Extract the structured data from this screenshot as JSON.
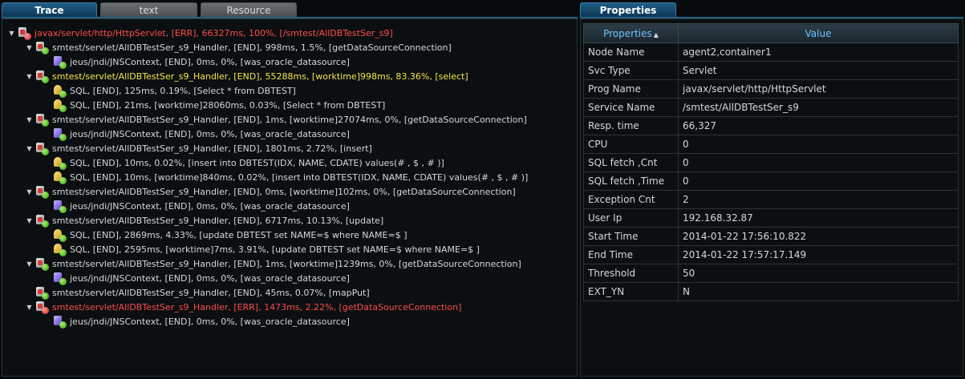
{
  "tabs": [
    {
      "label": "Trace",
      "active": true
    },
    {
      "label": "text",
      "active": false
    },
    {
      "label": "Resource",
      "active": false
    }
  ],
  "properties_tab": {
    "label": "Properties"
  },
  "tree": [
    {
      "depth": 0,
      "toggle": "▼",
      "icon": "service-error-icon",
      "style": "e",
      "text": "javax/servlet/http/HttpServlet, [ERR], 66327ms, 100%, [/smtest/AllDBTestSer_s9]"
    },
    {
      "depth": 1,
      "toggle": "▼",
      "icon": "service-icon",
      "style": "n",
      "text": "smtest/servlet/AllDBTestSer_s9_Handler, [END], 998ms, 1.5%, [getDataSourceConnection]"
    },
    {
      "depth": 2,
      "toggle": "",
      "icon": "jndi-icon",
      "style": "n",
      "text": "jeus/jndi/JNSContext, [END], 0ms, 0%, [was_oracle_datasource]"
    },
    {
      "depth": 1,
      "toggle": "▼",
      "icon": "service-icon",
      "style": "y",
      "text": "smtest/servlet/AllDBTestSer_s9_Handler, [END], 55288ms, [worktime]998ms, 83.36%, [select]"
    },
    {
      "depth": 2,
      "toggle": "",
      "icon": "sql-icon",
      "style": "n",
      "text": "SQL, [END], 125ms, 0.19%, [Select * from DBTEST]"
    },
    {
      "depth": 2,
      "toggle": "",
      "icon": "sql-icon",
      "style": "n",
      "text": "SQL, [END], 21ms, [worktime]28060ms, 0.03%, [Select * from DBTEST]"
    },
    {
      "depth": 1,
      "toggle": "▼",
      "icon": "service-icon",
      "style": "n",
      "text": "smtest/servlet/AllDBTestSer_s9_Handler, [END], 1ms, [worktime]27074ms, 0%, [getDataSourceConnection]"
    },
    {
      "depth": 2,
      "toggle": "",
      "icon": "jndi-icon",
      "style": "n",
      "text": "jeus/jndi/JNSContext, [END], 0ms, 0%, [was_oracle_datasource]"
    },
    {
      "depth": 1,
      "toggle": "▼",
      "icon": "service-icon",
      "style": "n",
      "text": "smtest/servlet/AllDBTestSer_s9_Handler, [END], 1801ms, 2.72%, [insert]"
    },
    {
      "depth": 2,
      "toggle": "",
      "icon": "sql-icon",
      "style": "n",
      "text": "SQL, [END], 10ms, 0.02%, [insert into DBTEST(IDX, NAME, CDATE) values(# , $ , # )]"
    },
    {
      "depth": 2,
      "toggle": "",
      "icon": "sql-icon",
      "style": "n",
      "text": "SQL, [END], 10ms, [worktime]840ms, 0.02%, [insert into DBTEST(IDX, NAME, CDATE) values(# , $ , # )]"
    },
    {
      "depth": 1,
      "toggle": "▼",
      "icon": "service-icon",
      "style": "n",
      "text": "smtest/servlet/AllDBTestSer_s9_Handler, [END], 0ms, [worktime]102ms, 0%, [getDataSourceConnection]"
    },
    {
      "depth": 2,
      "toggle": "",
      "icon": "jndi-icon",
      "style": "n",
      "text": "jeus/jndi/JNSContext, [END], 0ms, 0%, [was_oracle_datasource]"
    },
    {
      "depth": 1,
      "toggle": "▼",
      "icon": "service-icon",
      "style": "n",
      "text": "smtest/servlet/AllDBTestSer_s9_Handler, [END], 6717ms, 10.13%, [update]"
    },
    {
      "depth": 2,
      "toggle": "",
      "icon": "sql-icon",
      "style": "n",
      "text": "SQL, [END], 2869ms, 4.33%, [update DBTEST set NAME=$  where NAME=$ ]"
    },
    {
      "depth": 2,
      "toggle": "",
      "icon": "sql-icon",
      "style": "n",
      "text": "SQL, [END], 2595ms, [worktime]7ms, 3.91%, [update DBTEST set NAME=$  where NAME=$ ]"
    },
    {
      "depth": 1,
      "toggle": "▼",
      "icon": "service-icon",
      "style": "n",
      "text": "smtest/servlet/AllDBTestSer_s9_Handler, [END], 1ms, [worktime]1239ms, 0%, [getDataSourceConnection]"
    },
    {
      "depth": 2,
      "toggle": "",
      "icon": "jndi-icon",
      "style": "n",
      "text": "jeus/jndi/JNSContext, [END], 0ms, 0%, [was_oracle_datasource]"
    },
    {
      "depth": 1,
      "toggle": "",
      "icon": "service-icon",
      "style": "n",
      "text": "smtest/servlet/AllDBTestSer_s9_Handler, [END], 45ms, 0.07%, [mapPut]"
    },
    {
      "depth": 1,
      "toggle": "▼",
      "icon": "service-error-icon",
      "style": "e",
      "text": "smtest/servlet/AllDBTestSer_s9_Handler, [ERR], 1473ms, 2.22%, [getDataSourceConnection]"
    },
    {
      "depth": 2,
      "toggle": "",
      "icon": "jndi-icon",
      "style": "n",
      "text": "jeus/jndi/JNSContext, [END], 0ms, 0%, [was_oracle_datasource]"
    }
  ],
  "properties": {
    "header": {
      "name": "Properties",
      "value": "Value",
      "sort_indicator": "▲"
    },
    "rows": [
      {
        "name": "Node Name",
        "value": "agent2,container1"
      },
      {
        "name": "Svc Type",
        "value": "Servlet"
      },
      {
        "name": "Prog Name",
        "value": "javax/servlet/http/HttpServlet"
      },
      {
        "name": "Service Name",
        "value": "/smtest/AllDBTestSer_s9"
      },
      {
        "name": "Resp. time",
        "value": "66,327"
      },
      {
        "name": "CPU",
        "value": "0"
      },
      {
        "name": "SQL fetch ,Cnt",
        "value": "0"
      },
      {
        "name": "SQL fetch ,Time",
        "value": "0"
      },
      {
        "name": "Exception Cnt",
        "value": "2"
      },
      {
        "name": "User Ip",
        "value": "192.168.32.87"
      },
      {
        "name": "Start Time",
        "value": "2014-01-22 17:56:10.822"
      },
      {
        "name": "End Time",
        "value": "2014-01-22 17:57:17.149"
      },
      {
        "name": "Threshold",
        "value": "50"
      },
      {
        "name": "EXT_YN",
        "value": "N"
      }
    ]
  },
  "colors": {
    "error": "#ff4a4a",
    "highlight": "#f4e44a",
    "accent": "#1f5d85"
  }
}
